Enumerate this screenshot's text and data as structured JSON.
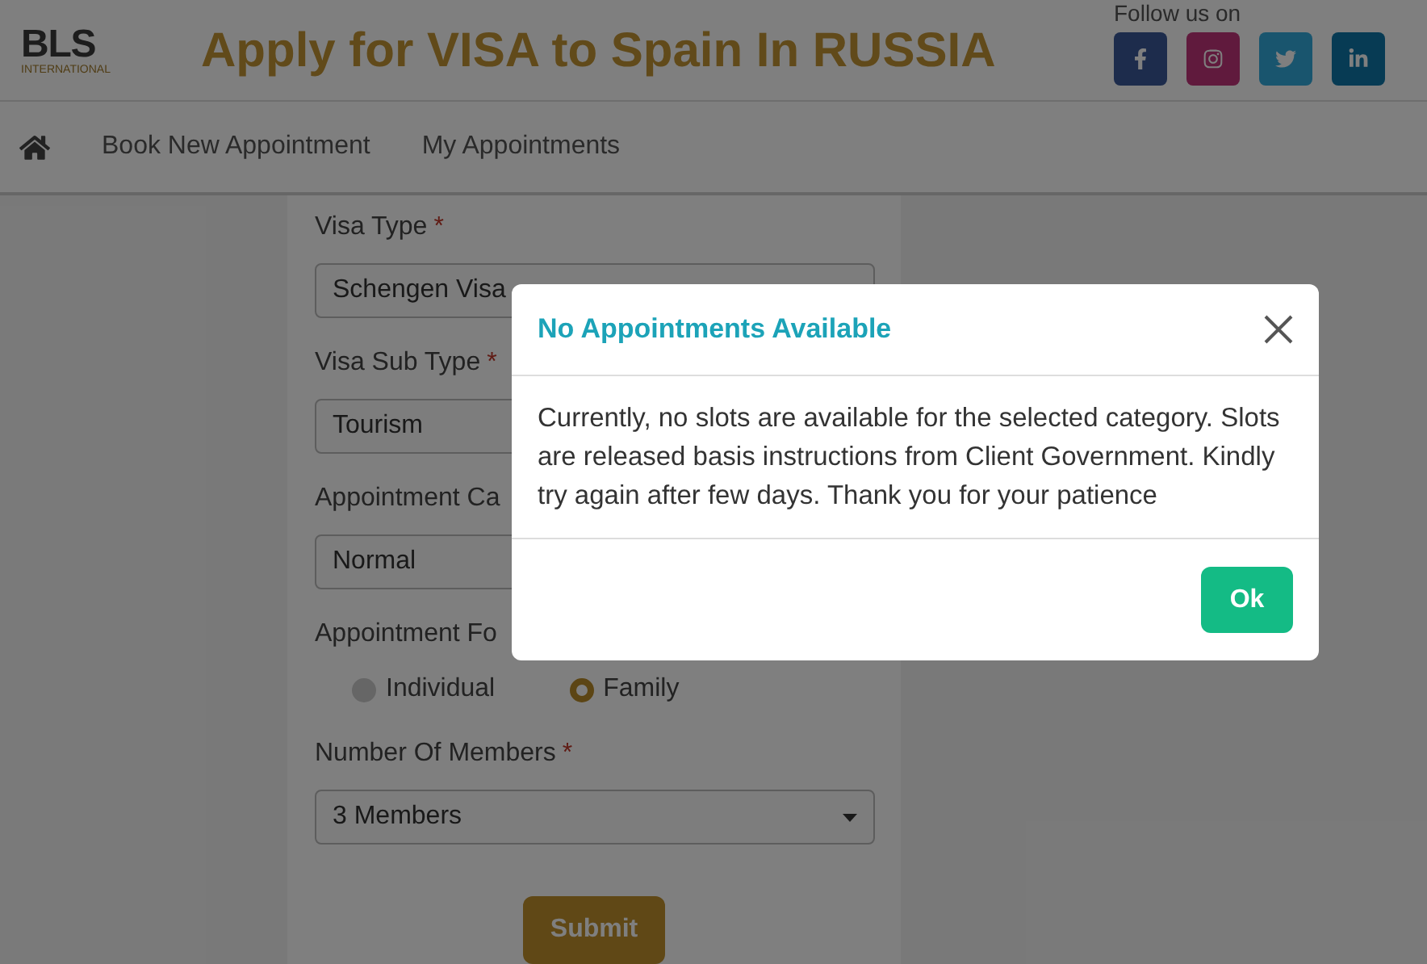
{
  "header": {
    "logo_text": "BLS",
    "logo_subtext": "INTERNATIONAL",
    "title": "Apply for VISA to Spain In RUSSIA",
    "follow_label": "Follow us on",
    "social": [
      {
        "kind": "facebook"
      },
      {
        "kind": "instagram"
      },
      {
        "kind": "twitter"
      },
      {
        "kind": "linkedin"
      }
    ]
  },
  "nav": {
    "items": [
      "Book New Appointment",
      "My Appointments"
    ]
  },
  "form": {
    "fields": [
      {
        "kind": "select",
        "label": "Visa Type",
        "required_mark": "*",
        "value": "Schengen Visa"
      },
      {
        "kind": "select",
        "label": "Visa Sub Type",
        "required_mark": "*",
        "value": "Tourism"
      },
      {
        "kind": "select",
        "label": "Appointment Ca",
        "value": "Normal"
      },
      {
        "kind": "radio",
        "label": "Appointment Fo",
        "options": [
          {
            "label": "Individual",
            "selected": false
          },
          {
            "label": "Family",
            "selected": true
          }
        ]
      },
      {
        "kind": "select",
        "label": "Number Of Members",
        "required_mark": "*",
        "value": "3 Members"
      }
    ],
    "submit": "Submit"
  },
  "dialog": {
    "title": "No Appointments Available",
    "message": "Currently, no slots are available for the selected category. Slots are released basis instructions from Client Government. Kindly try again after few days. Thank you for your patience",
    "ok": "Ok"
  }
}
